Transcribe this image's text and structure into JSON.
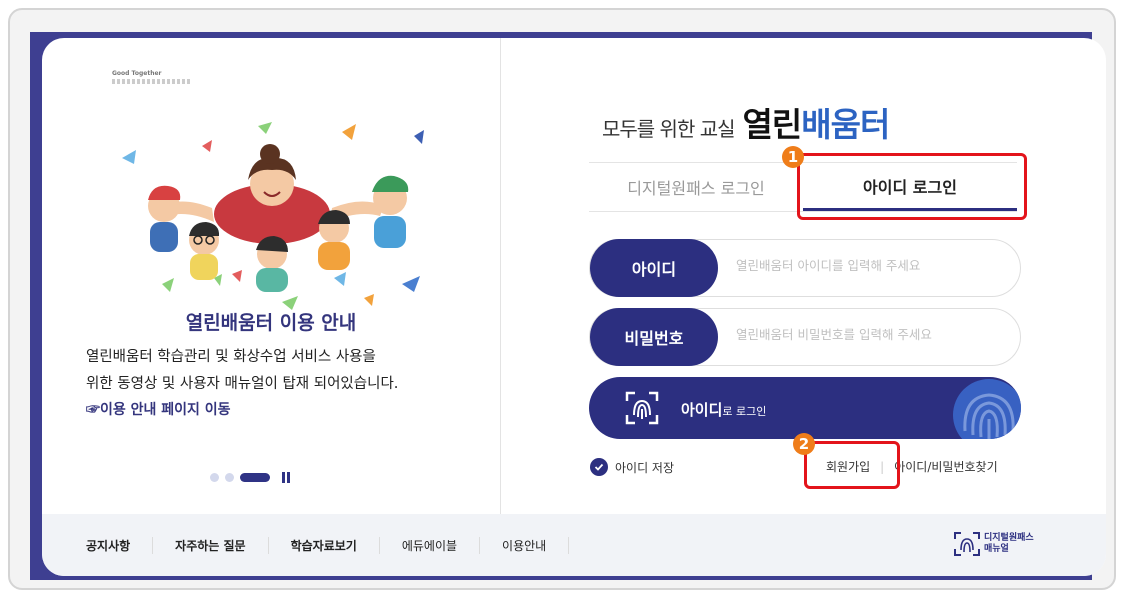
{
  "illustration": {
    "caption": "Good Together"
  },
  "info": {
    "title": "열린배움터 이용 안내",
    "text_line1": "열린배움터 학습관리 및 화상수업 서비스 사용을",
    "text_line2": "위한 동영상 및 사용자 매뉴얼이 탑재 되어있습니다.",
    "link": "☞이용 안내 페이지 이동"
  },
  "carousel": {
    "slides": 4,
    "active": 3
  },
  "brand": {
    "prefix": "모두를 위한 교실",
    "main": "열린",
    "accent": "배움터"
  },
  "tabs": {
    "digital_onepass": "디지털원패스 로그인",
    "id_login": "아이디 로그인"
  },
  "form": {
    "id_label": "아이디",
    "id_placeholder": "열린배움터 아이디를 입력해 주세요",
    "pw_label": "비밀번호",
    "pw_placeholder": "열린배움터 비밀번호를 입력해 주세요",
    "login_main": "아이디",
    "login_sub": "로 로그인"
  },
  "options": {
    "save_id": "아이디 저장",
    "signup": "회원가입",
    "find": "아이디/비밀번호찾기"
  },
  "bottom_nav": [
    "공지사항",
    "자주하는 질문",
    "학습자료보기",
    "에듀에이블",
    "이용안내"
  ],
  "manual": {
    "line1": "디지털원패스",
    "line2": "매뉴얼"
  },
  "annotations": {
    "badge1": "1",
    "badge2": "2"
  },
  "colors": {
    "navy": "#2c2f80",
    "accent_blue": "#2c63c2",
    "highlight_red": "#e3141b",
    "badge_orange": "#ef7d1a"
  }
}
